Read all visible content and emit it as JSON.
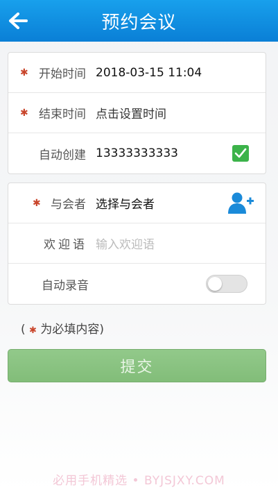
{
  "header": {
    "title": "预约会议"
  },
  "form1": {
    "start_label": "开始时间",
    "start_value": "2018-03-15 11:04",
    "end_label": "结束时间",
    "end_value": "点击设置时间",
    "auto_create_label": "自动创建",
    "auto_create_value": "13333333333",
    "auto_create_checked": true
  },
  "form2": {
    "participants_label": "与会者",
    "participants_value": "选择与会者",
    "welcome_label": "欢迎语",
    "welcome_placeholder": "输入欢迎语",
    "auto_record_label": "自动录音",
    "auto_record_on": false
  },
  "required_marker": "✱",
  "note": {
    "text_before": "(",
    "text_after": "为必填内容)"
  },
  "submit_label": "提交",
  "watermark": "必用手机精选 • BYJSJXY.COM",
  "colors": {
    "header": "#0a7fd6",
    "required": "#c9452b",
    "check": "#3cb34a",
    "submit": "#82bd79"
  },
  "icons": {
    "back": "arrow-left",
    "checkbox": "check",
    "add_participant": "person-add"
  }
}
